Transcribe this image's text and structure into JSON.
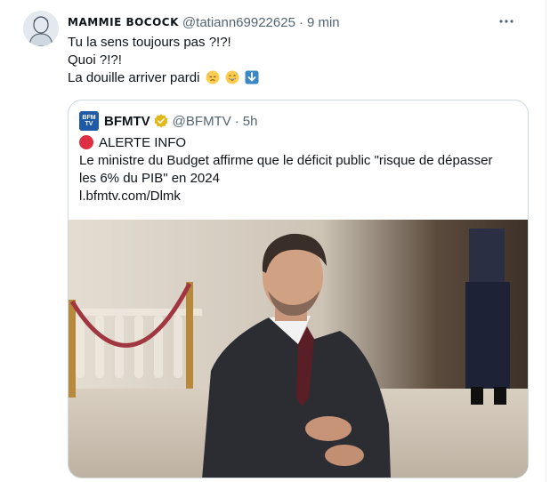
{
  "tweet": {
    "display_name": "MAMMIE BOCOCK",
    "handle": "@tatiann69922625",
    "separator": "·",
    "time": "9 min",
    "lines": [
      "Tu la sens toujours pas ?!?!",
      "Quoi ?!?!",
      "La douille arriver pardi"
    ],
    "emojis": [
      "downcast-sweat-face",
      "grinning-sweat-face",
      "down-arrow"
    ]
  },
  "quote": {
    "display_name": "BFMTV",
    "avatar_text": [
      "BFM",
      "TV"
    ],
    "handle": "@BFMTV",
    "separator": "·",
    "time": "5h",
    "alert": "ALERTE INFO",
    "text_lines": [
      "Le ministre du Budget affirme que le déficit public \"risque de dépasser",
      "les 6% du PIB\" en 2024"
    ],
    "link": "l.bfmtv.com/Dlmk"
  },
  "colors": {
    "text": "#0f1419",
    "secondary": "#536471",
    "border": "#cfd9de",
    "verified_gold": "#e2b719",
    "alert_red": "#dd2e44",
    "bfm_blue": "#1f5aa8"
  }
}
